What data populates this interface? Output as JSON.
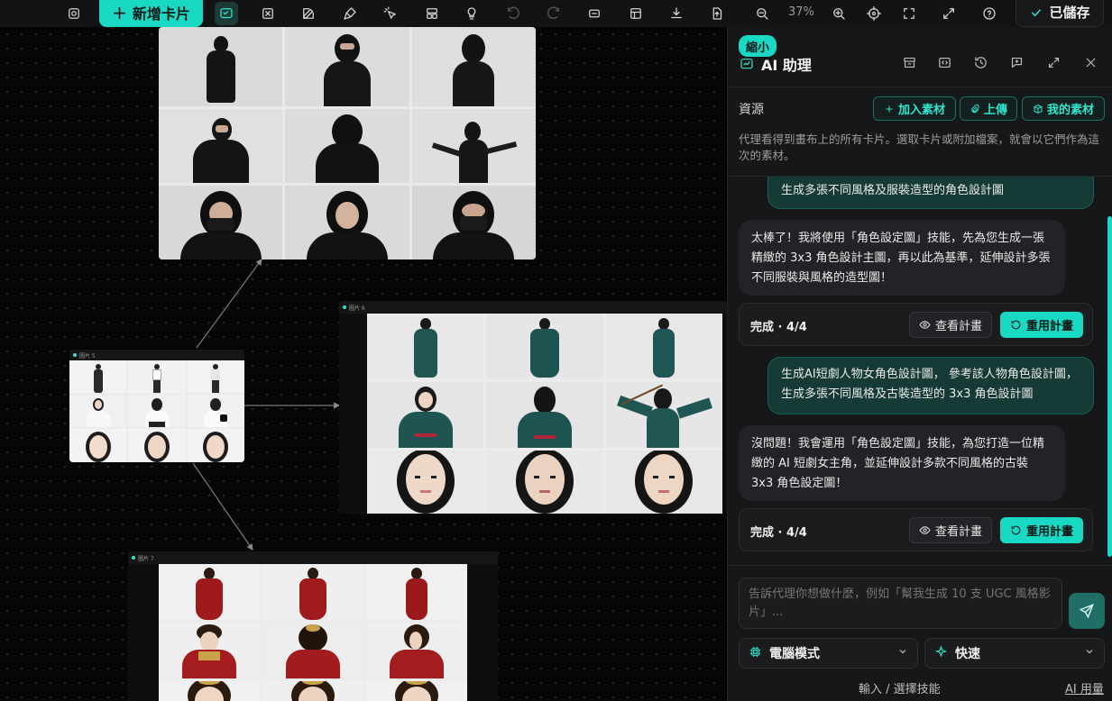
{
  "toolbar": {
    "add_card_label": "新增卡片",
    "zoom_level": "37%",
    "saved_label": "已儲存"
  },
  "canvas": {
    "cards": [
      {
        "title": ""
      },
      {
        "title": "圖片 6"
      },
      {
        "title": "圖片 5"
      },
      {
        "title": "圖片 7"
      }
    ]
  },
  "panel": {
    "shrink_label": "縮小",
    "title": "AI 助理",
    "resources": {
      "label": "資源",
      "add_material": "加入素材",
      "upload": "上傳",
      "my_materials": "我的素材",
      "description": "代理看得到畫布上的所有卡片。選取卡片或附加檔案，就會以它們作為這次的素材。"
    },
    "messages": [
      {
        "role": "user",
        "text": "生成多張不同風格及服裝造型的角色設計圖"
      },
      {
        "role": "assistant",
        "text": "太棒了！我將使用「角色設定圖」技能，先為您生成一張精緻的 3x3 角色設計主圖，再以此為基準，延伸設計多張不同服裝與風格的造型圖！"
      },
      {
        "role": "plan",
        "status": "完成 · 4/4",
        "view_label": "查看計畫",
        "reuse_label": "重用計畫"
      },
      {
        "role": "user",
        "text": "生成AI短劇人物女角色設計圖， 參考該人物角色設計圖，生成多張不同風格及古裝造型的 3x3 角色設計圖"
      },
      {
        "role": "assistant",
        "text": "沒問題！我會運用「角色設定圖」技能，為您打造一位精緻的 AI 短劇女主角，並延伸設計多款不同風格的古裝 3x3 角色設定圖！"
      },
      {
        "role": "plan",
        "status": "完成 · 4/4",
        "view_label": "查看計畫",
        "reuse_label": "重用計畫"
      }
    ],
    "input_placeholder": "告訴代理你想做什麼，例如「幫我生成 10 支 UGC 風格影片」...",
    "mode_select": "電腦模式",
    "speed_select": "快速",
    "skill_link": "輸入 / 選擇技能",
    "usage_link": "AI 用量"
  },
  "colors": {
    "accent": "#19d9c4",
    "panel_bg": "#161718",
    "user_bubble": "#163a35"
  }
}
